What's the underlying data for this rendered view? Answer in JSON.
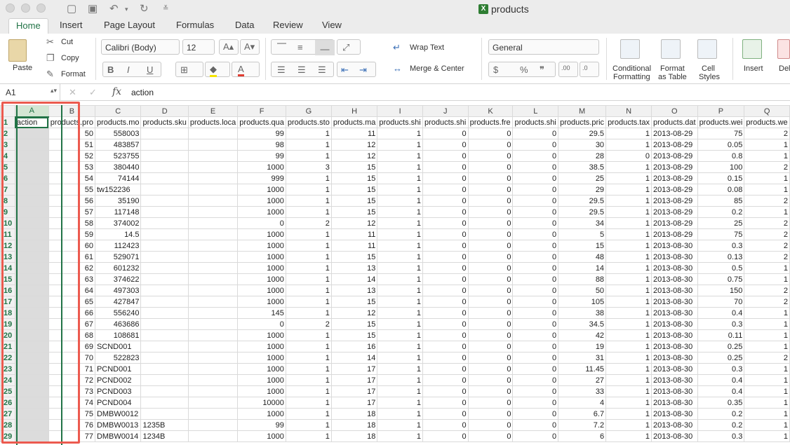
{
  "window": {
    "title": "products"
  },
  "tabs": [
    "Home",
    "Insert",
    "Page Layout",
    "Formulas",
    "Data",
    "Review",
    "View"
  ],
  "ribbon": {
    "paste": "Paste",
    "cut": "Cut",
    "copy": "Copy",
    "format": "Format",
    "font_name": "Calibri (Body)",
    "font_size": "12",
    "wrap_text": "Wrap Text",
    "merge_center": "Merge & Center",
    "number_format": "General",
    "conditional_formatting_1": "Conditional",
    "conditional_formatting_2": "Formatting",
    "format_table_1": "Format",
    "format_table_2": "as Table",
    "cell_styles_1": "Cell",
    "cell_styles_2": "Styles",
    "insert": "Insert",
    "delete": "Del"
  },
  "formula_bar": {
    "name_box": "A1",
    "fx": "fx",
    "value": "action"
  },
  "grid": {
    "columns": [
      "A",
      "B",
      "C",
      "D",
      "E",
      "F",
      "G",
      "H",
      "I",
      "J",
      "K",
      "L",
      "M",
      "N",
      "O",
      "P",
      "Q"
    ],
    "rows": [
      [
        "action",
        "products.pro",
        "products.mo",
        "products.sku",
        "products.loca",
        "products.qua",
        "products.sto",
        "products.ma",
        "products.shi",
        "products.shi",
        "products.fre",
        "products.shi",
        "products.pric",
        "products.tax",
        "products.dat",
        "products.wei",
        "products.we"
      ],
      [
        "",
        "50",
        "558003",
        "",
        "",
        "99",
        "1",
        "11",
        "1",
        "0",
        "0",
        "0",
        "29.5",
        "1",
        "2013-08-29",
        "75",
        "2"
      ],
      [
        "",
        "51",
        "483857",
        "",
        "",
        "98",
        "1",
        "12",
        "1",
        "0",
        "0",
        "0",
        "30",
        "1",
        "2013-08-29",
        "0.05",
        "1"
      ],
      [
        "",
        "52",
        "523755",
        "",
        "",
        "99",
        "1",
        "12",
        "1",
        "0",
        "0",
        "0",
        "28",
        "0",
        "2013-08-29",
        "0.8",
        "1"
      ],
      [
        "",
        "53",
        "380440",
        "",
        "",
        "1000",
        "3",
        "15",
        "1",
        "0",
        "0",
        "0",
        "38.5",
        "1",
        "2013-08-29",
        "100",
        "2"
      ],
      [
        "",
        "54",
        "74144",
        "",
        "",
        "999",
        "1",
        "15",
        "1",
        "0",
        "0",
        "0",
        "25",
        "1",
        "2013-08-29",
        "0.15",
        "1"
      ],
      [
        "",
        "55",
        "tw152236",
        "",
        "",
        "1000",
        "1",
        "15",
        "1",
        "0",
        "0",
        "0",
        "29",
        "1",
        "2013-08-29",
        "0.08",
        "1"
      ],
      [
        "",
        "56",
        "35190",
        "",
        "",
        "1000",
        "1",
        "15",
        "1",
        "0",
        "0",
        "0",
        "29.5",
        "1",
        "2013-08-29",
        "85",
        "2"
      ],
      [
        "",
        "57",
        "117148",
        "",
        "",
        "1000",
        "1",
        "15",
        "1",
        "0",
        "0",
        "0",
        "29.5",
        "1",
        "2013-08-29",
        "0.2",
        "1"
      ],
      [
        "",
        "58",
        "374002",
        "",
        "",
        "0",
        "2",
        "12",
        "1",
        "0",
        "0",
        "0",
        "34",
        "1",
        "2013-08-29",
        "25",
        "2"
      ],
      [
        "",
        "59",
        "14.5",
        "",
        "",
        "1000",
        "1",
        "11",
        "1",
        "0",
        "0",
        "0",
        "5",
        "1",
        "2013-08-29",
        "75",
        "2"
      ],
      [
        "",
        "60",
        "112423",
        "",
        "",
        "1000",
        "1",
        "11",
        "1",
        "0",
        "0",
        "0",
        "15",
        "1",
        "2013-08-30",
        "0.3",
        "2"
      ],
      [
        "",
        "61",
        "529071",
        "",
        "",
        "1000",
        "1",
        "15",
        "1",
        "0",
        "0",
        "0",
        "48",
        "1",
        "2013-08-30",
        "0.13",
        "2"
      ],
      [
        "",
        "62",
        "601232",
        "",
        "",
        "1000",
        "1",
        "13",
        "1",
        "0",
        "0",
        "0",
        "14",
        "1",
        "2013-08-30",
        "0.5",
        "1"
      ],
      [
        "",
        "63",
        "374622",
        "",
        "",
        "1000",
        "1",
        "14",
        "1",
        "0",
        "0",
        "0",
        "88",
        "1",
        "2013-08-30",
        "0.75",
        "1"
      ],
      [
        "",
        "64",
        "497303",
        "",
        "",
        "1000",
        "1",
        "13",
        "1",
        "0",
        "0",
        "0",
        "50",
        "1",
        "2013-08-30",
        "150",
        "2"
      ],
      [
        "",
        "65",
        "427847",
        "",
        "",
        "1000",
        "1",
        "15",
        "1",
        "0",
        "0",
        "0",
        "105",
        "1",
        "2013-08-30",
        "70",
        "2"
      ],
      [
        "",
        "66",
        "556240",
        "",
        "",
        "145",
        "1",
        "12",
        "1",
        "0",
        "0",
        "0",
        "38",
        "1",
        "2013-08-30",
        "0.4",
        "1"
      ],
      [
        "",
        "67",
        "463686",
        "",
        "",
        "0",
        "2",
        "15",
        "1",
        "0",
        "0",
        "0",
        "34.5",
        "1",
        "2013-08-30",
        "0.3",
        "1"
      ],
      [
        "",
        "68",
        "108681",
        "",
        "",
        "1000",
        "1",
        "15",
        "1",
        "0",
        "0",
        "0",
        "42",
        "1",
        "2013-08-30",
        "0.11",
        "1"
      ],
      [
        "",
        "69",
        "SCND001",
        "",
        "",
        "1000",
        "1",
        "16",
        "1",
        "0",
        "0",
        "0",
        "19",
        "1",
        "2013-08-30",
        "0.25",
        "1"
      ],
      [
        "",
        "70",
        "522823",
        "",
        "",
        "1000",
        "1",
        "14",
        "1",
        "0",
        "0",
        "0",
        "31",
        "1",
        "2013-08-30",
        "0.25",
        "2"
      ],
      [
        "",
        "71",
        "PCND001",
        "",
        "",
        "1000",
        "1",
        "17",
        "1",
        "0",
        "0",
        "0",
        "11.45",
        "1",
        "2013-08-30",
        "0.3",
        "1"
      ],
      [
        "",
        "72",
        "PCND002",
        "",
        "",
        "1000",
        "1",
        "17",
        "1",
        "0",
        "0",
        "0",
        "27",
        "1",
        "2013-08-30",
        "0.4",
        "1"
      ],
      [
        "",
        "73",
        "PCND003",
        "",
        "",
        "1000",
        "1",
        "17",
        "1",
        "0",
        "0",
        "0",
        "33",
        "1",
        "2013-08-30",
        "0.4",
        "1"
      ],
      [
        "",
        "74",
        "PCND004",
        "",
        "",
        "10000",
        "1",
        "17",
        "1",
        "0",
        "0",
        "0",
        "4",
        "1",
        "2013-08-30",
        "0.35",
        "1"
      ],
      [
        "",
        "75",
        "DMBW0012",
        "",
        "",
        "1000",
        "1",
        "18",
        "1",
        "0",
        "0",
        "0",
        "6.7",
        "1",
        "2013-08-30",
        "0.2",
        "1"
      ],
      [
        "",
        "76",
        "DMBW0013",
        "1235B",
        "",
        "99",
        "1",
        "18",
        "1",
        "0",
        "0",
        "0",
        "7.2",
        "1",
        "2013-08-30",
        "0.2",
        "1"
      ],
      [
        "",
        "77",
        "DMBW0014",
        "1234B",
        "",
        "1000",
        "1",
        "18",
        "1",
        "0",
        "0",
        "0",
        "6",
        "1",
        "2013-08-30",
        "0.3",
        "1"
      ]
    ]
  }
}
